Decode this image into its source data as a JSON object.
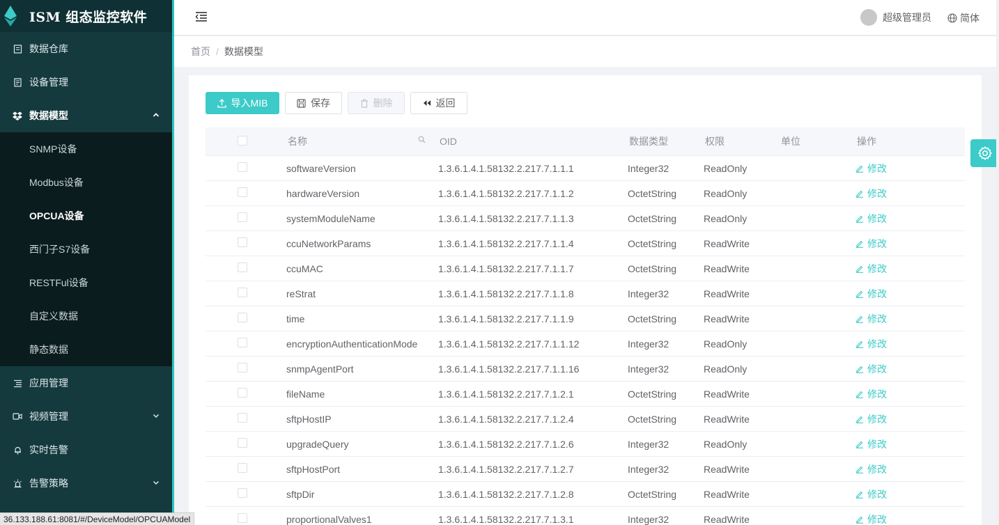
{
  "app": {
    "title": "ISM 组态监控软件"
  },
  "sidebar": {
    "items": [
      {
        "label": "数据仓库",
        "icon": "database-icon"
      },
      {
        "label": "设备管理",
        "icon": "device-icon"
      },
      {
        "label": "数据模型",
        "icon": "dropbox-icon",
        "expanded": true
      },
      {
        "label": "应用管理",
        "icon": "list-icon"
      },
      {
        "label": "视频管理",
        "icon": "video-icon"
      },
      {
        "label": "实时告警",
        "icon": "bell-icon"
      },
      {
        "label": "告警策略",
        "icon": "alarm-light-icon"
      }
    ],
    "submenu": [
      {
        "label": "SNMP设备"
      },
      {
        "label": "Modbus设备"
      },
      {
        "label": "OPCUA设备",
        "current": true
      },
      {
        "label": "西门子S7设备"
      },
      {
        "label": "RESTFul设备"
      },
      {
        "label": "自定义数据"
      },
      {
        "label": "静态数据"
      }
    ]
  },
  "header": {
    "user_name": "超级管理员",
    "language": "简体"
  },
  "breadcrumb": {
    "home": "首页",
    "separator": "/",
    "current": "数据模型"
  },
  "toolbar": {
    "import_label": "导入MIB",
    "save_label": "保存",
    "delete_label": "删除",
    "back_label": "返回"
  },
  "table": {
    "columns": {
      "name": "名称",
      "oid": "OID",
      "type": "数据类型",
      "permission": "权限",
      "unit": "单位",
      "action": "操作"
    },
    "edit_label": "修改",
    "rows": [
      {
        "name": "softwareVersion",
        "oid": "1.3.6.1.4.1.58132.2.217.7.1.1.1",
        "type": "Integer32",
        "permission": "ReadOnly",
        "unit": ""
      },
      {
        "name": "hardwareVersion",
        "oid": "1.3.6.1.4.1.58132.2.217.7.1.1.2",
        "type": "OctetString",
        "permission": "ReadOnly",
        "unit": ""
      },
      {
        "name": "systemModuleName",
        "oid": "1.3.6.1.4.1.58132.2.217.7.1.1.3",
        "type": "OctetString",
        "permission": "ReadOnly",
        "unit": ""
      },
      {
        "name": "ccuNetworkParams",
        "oid": "1.3.6.1.4.1.58132.2.217.7.1.1.4",
        "type": "OctetString",
        "permission": "ReadWrite",
        "unit": ""
      },
      {
        "name": "ccuMAC",
        "oid": "1.3.6.1.4.1.58132.2.217.7.1.1.7",
        "type": "OctetString",
        "permission": "ReadWrite",
        "unit": ""
      },
      {
        "name": "reStrat",
        "oid": "1.3.6.1.4.1.58132.2.217.7.1.1.8",
        "type": "Integer32",
        "permission": "ReadWrite",
        "unit": ""
      },
      {
        "name": "time",
        "oid": "1.3.6.1.4.1.58132.2.217.7.1.1.9",
        "type": "OctetString",
        "permission": "ReadWrite",
        "unit": ""
      },
      {
        "name": "encryptionAuthenticationMode",
        "oid": "1.3.6.1.4.1.58132.2.217.7.1.1.12",
        "type": "Integer32",
        "permission": "ReadOnly",
        "unit": ""
      },
      {
        "name": "snmpAgentPort",
        "oid": "1.3.6.1.4.1.58132.2.217.7.1.1.16",
        "type": "Integer32",
        "permission": "ReadOnly",
        "unit": ""
      },
      {
        "name": "fileName",
        "oid": "1.3.6.1.4.1.58132.2.217.7.1.2.1",
        "type": "OctetString",
        "permission": "ReadWrite",
        "unit": ""
      },
      {
        "name": "sftpHostIP",
        "oid": "1.3.6.1.4.1.58132.2.217.7.1.2.4",
        "type": "OctetString",
        "permission": "ReadWrite",
        "unit": ""
      },
      {
        "name": "upgradeQuery",
        "oid": "1.3.6.1.4.1.58132.2.217.7.1.2.6",
        "type": "Integer32",
        "permission": "ReadOnly",
        "unit": ""
      },
      {
        "name": "sftpHostPort",
        "oid": "1.3.6.1.4.1.58132.2.217.7.1.2.7",
        "type": "Integer32",
        "permission": "ReadWrite",
        "unit": ""
      },
      {
        "name": "sftpDir",
        "oid": "1.3.6.1.4.1.58132.2.217.7.1.2.8",
        "type": "OctetString",
        "permission": "ReadWrite",
        "unit": ""
      },
      {
        "name": "proportionalValves1",
        "oid": "1.3.6.1.4.1.58132.2.217.7.1.3.1",
        "type": "Integer32",
        "permission": "ReadWrite",
        "unit": ""
      }
    ]
  },
  "status_bar": {
    "url": "36.133.188.61:8081/#/DeviceModel/OPCUAModel"
  },
  "colors": {
    "sidebar_bg": "#143a3e",
    "submenu_bg": "#0b1c1e",
    "accent": "#3ccbc8"
  }
}
